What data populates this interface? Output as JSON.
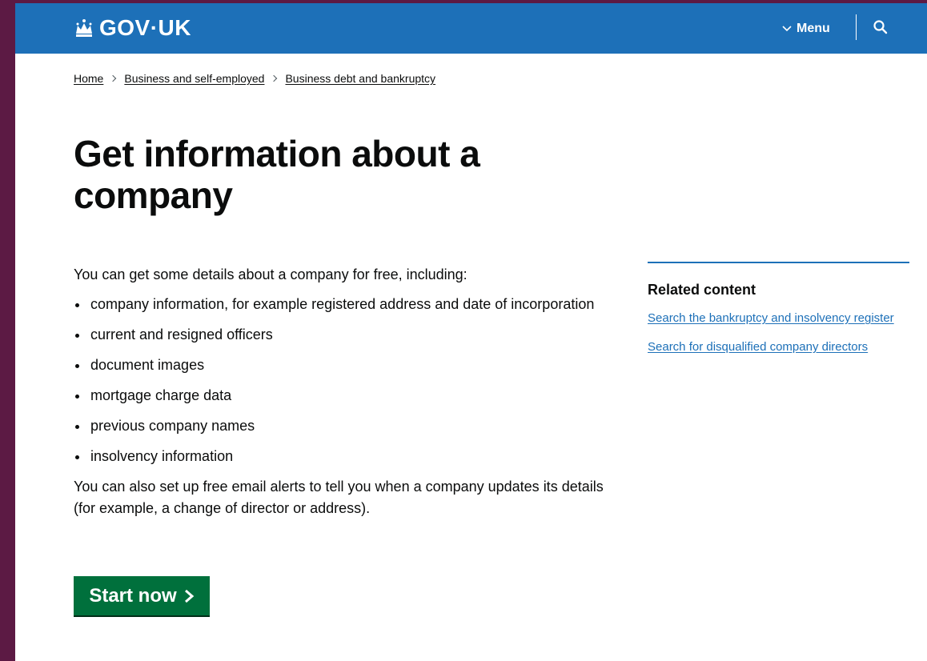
{
  "header": {
    "logo_text": "GOV·UK",
    "menu_label": "Menu",
    "brand_color": "#1d70b8"
  },
  "breadcrumb": [
    {
      "label": "Home"
    },
    {
      "label": "Business and self-employed"
    },
    {
      "label": "Business debt and bankruptcy"
    }
  ],
  "page": {
    "title": "Get information about a company",
    "intro": "You can get some details about a company for free, including:",
    "bullets": [
      "company information, for example registered address and date of incorporation",
      "current and resigned officers",
      "document images",
      "mortgage charge data",
      "previous company names",
      "insolvency information"
    ],
    "alerts_text": "You can also set up free email alerts to tell you when a company updates its details (for example, a change of director or address).",
    "start_button_label": "Start now",
    "start_button_color": "#00703c"
  },
  "related": {
    "heading": "Related content",
    "links": [
      "Search the bankruptcy and insolvency register",
      "Search for disqualified company directors"
    ]
  }
}
